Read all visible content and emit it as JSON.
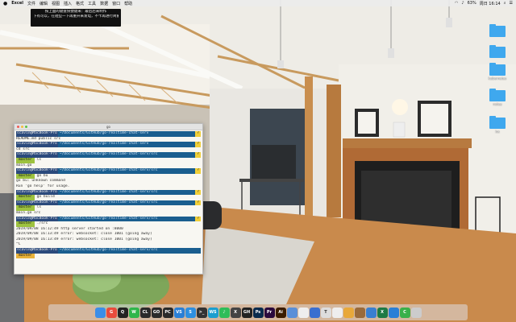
{
  "menubar": {
    "apple": "",
    "app": "Excel",
    "items": [
      "文件",
      "编辑",
      "视图",
      "插入",
      "格式",
      "工具",
      "数据",
      "窗口",
      "帮助"
    ],
    "right": {
      "battery": "63%",
      "clock": "周日 16:14"
    }
  },
  "notice": {
    "line1": "按上面的键盘快捷键来：最后后来制作",
    "line2": "下有可以，在短些一下再重开来发电，不卡再进行简繁体"
  },
  "desktop_folders": [
    {
      "label": ""
    },
    {
      "label": ""
    },
    {
      "label": "kubernetes"
    },
    {
      "label": "notes"
    },
    {
      "label": "ios"
    }
  ],
  "terminal": {
    "title": "go",
    "lines": [
      {
        "kind": "prompt",
        "user": "scavin@MacBook-Pro",
        "path": "~/Documents/GitHub/go-realtime-chat-serv",
        "tag": "?"
      },
      {
        "kind": "out",
        "text": "README.md  public   src"
      },
      {
        "kind": "prompt",
        "user": "scavin@MacBook-Pro",
        "path": "~/Documents/GitHub/go-realtime-chat-serv",
        "tag": "?"
      },
      {
        "kind": "out",
        "text": "cd src"
      },
      {
        "kind": "prompt",
        "user": "scavin@MacBook-Pro",
        "path": "~/Documents/GitHub/go-realtime-chat-serv/src",
        "tag": "?"
      },
      {
        "kind": "branch",
        "branch": "master",
        "cmd": "ls"
      },
      {
        "kind": "out",
        "text": "main.go"
      },
      {
        "kind": "prompt",
        "user": "scavin@MacBook-Pro",
        "path": "~/Documents/GitHub/go-realtime-chat-serv/src",
        "tag": "?"
      },
      {
        "kind": "branch",
        "branch": "master",
        "cmd": "go bu"
      },
      {
        "kind": "out",
        "text": "go bu: unknown command"
      },
      {
        "kind": "out",
        "text": "Run 'go help' for usage."
      },
      {
        "kind": "prompt",
        "user": "scavin@MacBook-Pro",
        "path": "~/Documents/GitHub/go-realtime-chat-serv/src",
        "tag": "?"
      },
      {
        "kind": "branch",
        "branch": "master",
        "cmd": "go build"
      },
      {
        "kind": "prompt",
        "user": "scavin@MacBook-Pro",
        "path": "~/Documents/GitHub/go-realtime-chat-serv/src",
        "tag": "?"
      },
      {
        "kind": "branch",
        "branch": "master",
        "cmd": "ls"
      },
      {
        "kind": "out",
        "text": "main.go  src"
      },
      {
        "kind": "prompt",
        "user": "scavin@MacBook-Pro",
        "path": "~/Documents/GitHub/go-realtime-chat-serv/src",
        "tag": "?"
      },
      {
        "kind": "branch",
        "branch": "master",
        "cmd": "./src"
      },
      {
        "kind": "out",
        "text": "2019/09/08 16:12:49 http server started on :8000"
      },
      {
        "kind": "out",
        "text": "2019/09/08 16:13:49 error: websocket: close 1001 (going away)"
      },
      {
        "kind": "out",
        "text": "2019/09/08 16:13:49 error: websocket: close 1001 (going away)"
      },
      {
        "kind": "out",
        "text": "^C"
      },
      {
        "kind": "prompt",
        "user": "scavin@MacBook-Pro",
        "path": "~/Documents/GitHub/go-realtime-chat-serv/src",
        "tag": ""
      },
      {
        "kind": "branch",
        "branch": "master",
        "cmd": "",
        "warn": true
      }
    ]
  },
  "dock": {
    "icons": [
      {
        "name": "finder-icon",
        "label": "",
        "color": "#3b8ee8"
      },
      {
        "name": "chrome-icon",
        "label": "G",
        "color": "#e94b3c"
      },
      {
        "name": "qq-icon",
        "label": "Q",
        "color": "#222"
      },
      {
        "name": "wechat-icon",
        "label": "W",
        "color": "#2fb64b"
      },
      {
        "name": "clion-icon",
        "label": "CL",
        "color": "#2a2a2a"
      },
      {
        "name": "goland-icon",
        "label": "GO",
        "color": "#2a2a2a"
      },
      {
        "name": "pycharm-icon",
        "label": "PC",
        "color": "#2a2a2a"
      },
      {
        "name": "vscode-icon",
        "label": "VS",
        "color": "#2a7fd6"
      },
      {
        "name": "safari-icon",
        "label": "S",
        "color": "#2d8fe0"
      },
      {
        "name": "terminal-icon",
        "label": ">_",
        "color": "#333"
      },
      {
        "name": "webstorm-icon",
        "label": "WS",
        "color": "#1b9ecf"
      },
      {
        "name": "spotify-icon",
        "label": "♪",
        "color": "#2ebd59"
      },
      {
        "name": "x-icon",
        "label": "X",
        "color": "#444"
      },
      {
        "name": "github-icon",
        "label": "GH",
        "color": "#222"
      },
      {
        "name": "photoshop-icon",
        "label": "Ps",
        "color": "#0a2b4d"
      },
      {
        "name": "premiere-icon",
        "label": "Pr",
        "color": "#2a0a3d"
      },
      {
        "name": "illustrator-icon",
        "label": "Ai",
        "color": "#3a1c00"
      },
      {
        "name": "network-icon",
        "label": "",
        "color": "#5a8fd8"
      },
      {
        "name": "calendar-icon",
        "label": "",
        "color": "#eee"
      },
      {
        "name": "keynote-icon",
        "label": "",
        "color": "#3a6fd0"
      },
      {
        "name": "typora-icon",
        "label": "T",
        "color": "#ddd"
      },
      {
        "name": "app-icon",
        "label": "",
        "color": "#eee"
      },
      {
        "name": "snail-icon",
        "label": "",
        "color": "#e8a83a"
      },
      {
        "name": "app2-icon",
        "label": "",
        "color": "#9a6a3a"
      },
      {
        "name": "vm-icon",
        "label": "",
        "color": "#3a7fd0"
      },
      {
        "name": "excel-icon",
        "label": "X",
        "color": "#1d7a45"
      },
      {
        "name": "keynote2-icon",
        "label": "",
        "color": "#2a7fd6"
      },
      {
        "name": "c-icon",
        "label": "C",
        "color": "#3ab04a"
      },
      {
        "name": "trash-icon",
        "label": "",
        "color": "#ccc"
      }
    ]
  }
}
